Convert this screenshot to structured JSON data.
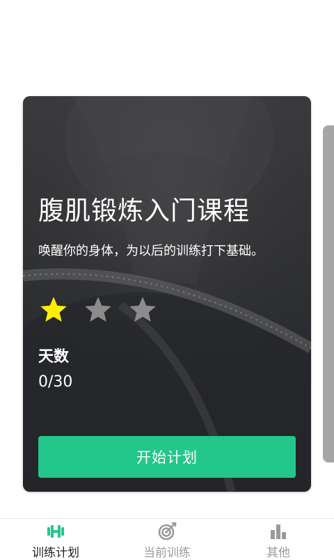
{
  "course": {
    "title": "腹肌锻炼入门课程",
    "subtitle": "唤醒你的身体，为以后的训练打下基础。",
    "difficulty": {
      "rating": 1,
      "max": 3
    },
    "days_label": "天数",
    "days_value": "0/30",
    "start_button": "开始计划"
  },
  "tabs": [
    {
      "label": "训练计划",
      "icon": "dumbbell-icon",
      "active": true
    },
    {
      "label": "当前训练",
      "icon": "target-icon",
      "active": false
    },
    {
      "label": "其他",
      "icon": "bar-chart-icon",
      "active": false
    }
  ],
  "colors": {
    "accent": "#23c68b",
    "star_active": "#ffee00",
    "star_inactive": "#8c8c8c",
    "tab_inactive": "#9a9a9a"
  }
}
